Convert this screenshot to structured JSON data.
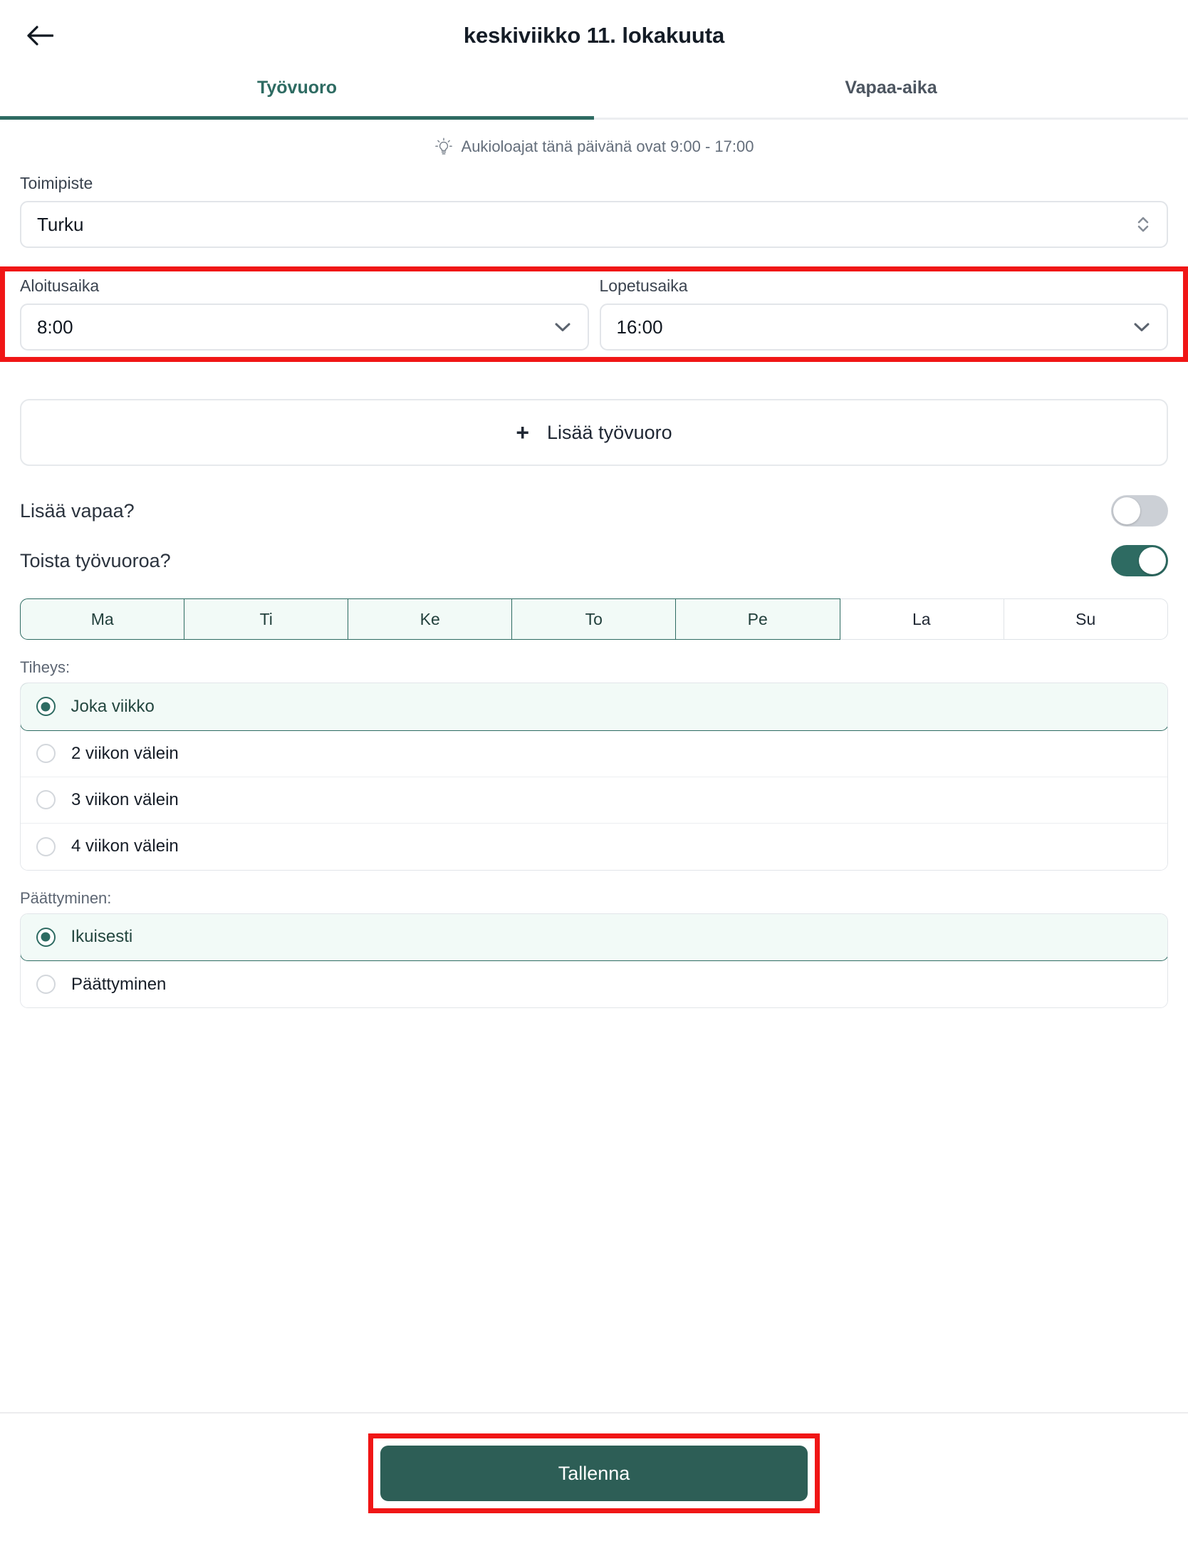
{
  "header": {
    "back_icon": "arrow-left-icon",
    "title": "keskiviikko 11. lokakuuta"
  },
  "tabs": [
    {
      "label": "Työvuoro",
      "active": true
    },
    {
      "label": "Vapaa-aika",
      "active": false
    }
  ],
  "hint": {
    "icon": "lightbulb-icon",
    "text": "Aukioloajat tänä päivänä ovat 9:00 - 17:00"
  },
  "location": {
    "label": "Toimipiste",
    "value": "Turku",
    "icon": "chevron-up-down-icon"
  },
  "start_time": {
    "label": "Aloitusaika",
    "value": "8:00",
    "icon": "chevron-down-icon"
  },
  "end_time": {
    "label": "Lopetusaika",
    "value": "16:00",
    "icon": "chevron-down-icon"
  },
  "add_shift": {
    "plus": "+",
    "label": "Lisää työvuoro"
  },
  "toggles": [
    {
      "label": "Lisää vapaa?",
      "on": false
    },
    {
      "label": "Toista työvuoroa?",
      "on": true
    }
  ],
  "weekdays": [
    {
      "label": "Ma",
      "selected": true
    },
    {
      "label": "Ti",
      "selected": true
    },
    {
      "label": "Ke",
      "selected": true
    },
    {
      "label": "To",
      "selected": true
    },
    {
      "label": "Pe",
      "selected": true
    },
    {
      "label": "La",
      "selected": false
    },
    {
      "label": "Su",
      "selected": false
    }
  ],
  "frequency": {
    "label": "Tiheys:",
    "options": [
      {
        "label": "Joka viikko",
        "selected": true
      },
      {
        "label": "2 viikon välein",
        "selected": false
      },
      {
        "label": "3 viikon välein",
        "selected": false
      },
      {
        "label": "4 viikon välein",
        "selected": false
      }
    ]
  },
  "ending": {
    "label": "Päättyminen:",
    "options": [
      {
        "label": "Ikuisesti",
        "selected": true
      },
      {
        "label": "Päättyminen",
        "selected": false
      }
    ]
  },
  "footer": {
    "save_label": "Tallenna"
  },
  "colors": {
    "accent": "#2e6b62",
    "accent_dark": "#2d5e56",
    "accent_tint": "#f2faf7",
    "annotation": "#f01616",
    "toggle_off": "#ccd0d6",
    "muted_text": "#646e7b"
  }
}
